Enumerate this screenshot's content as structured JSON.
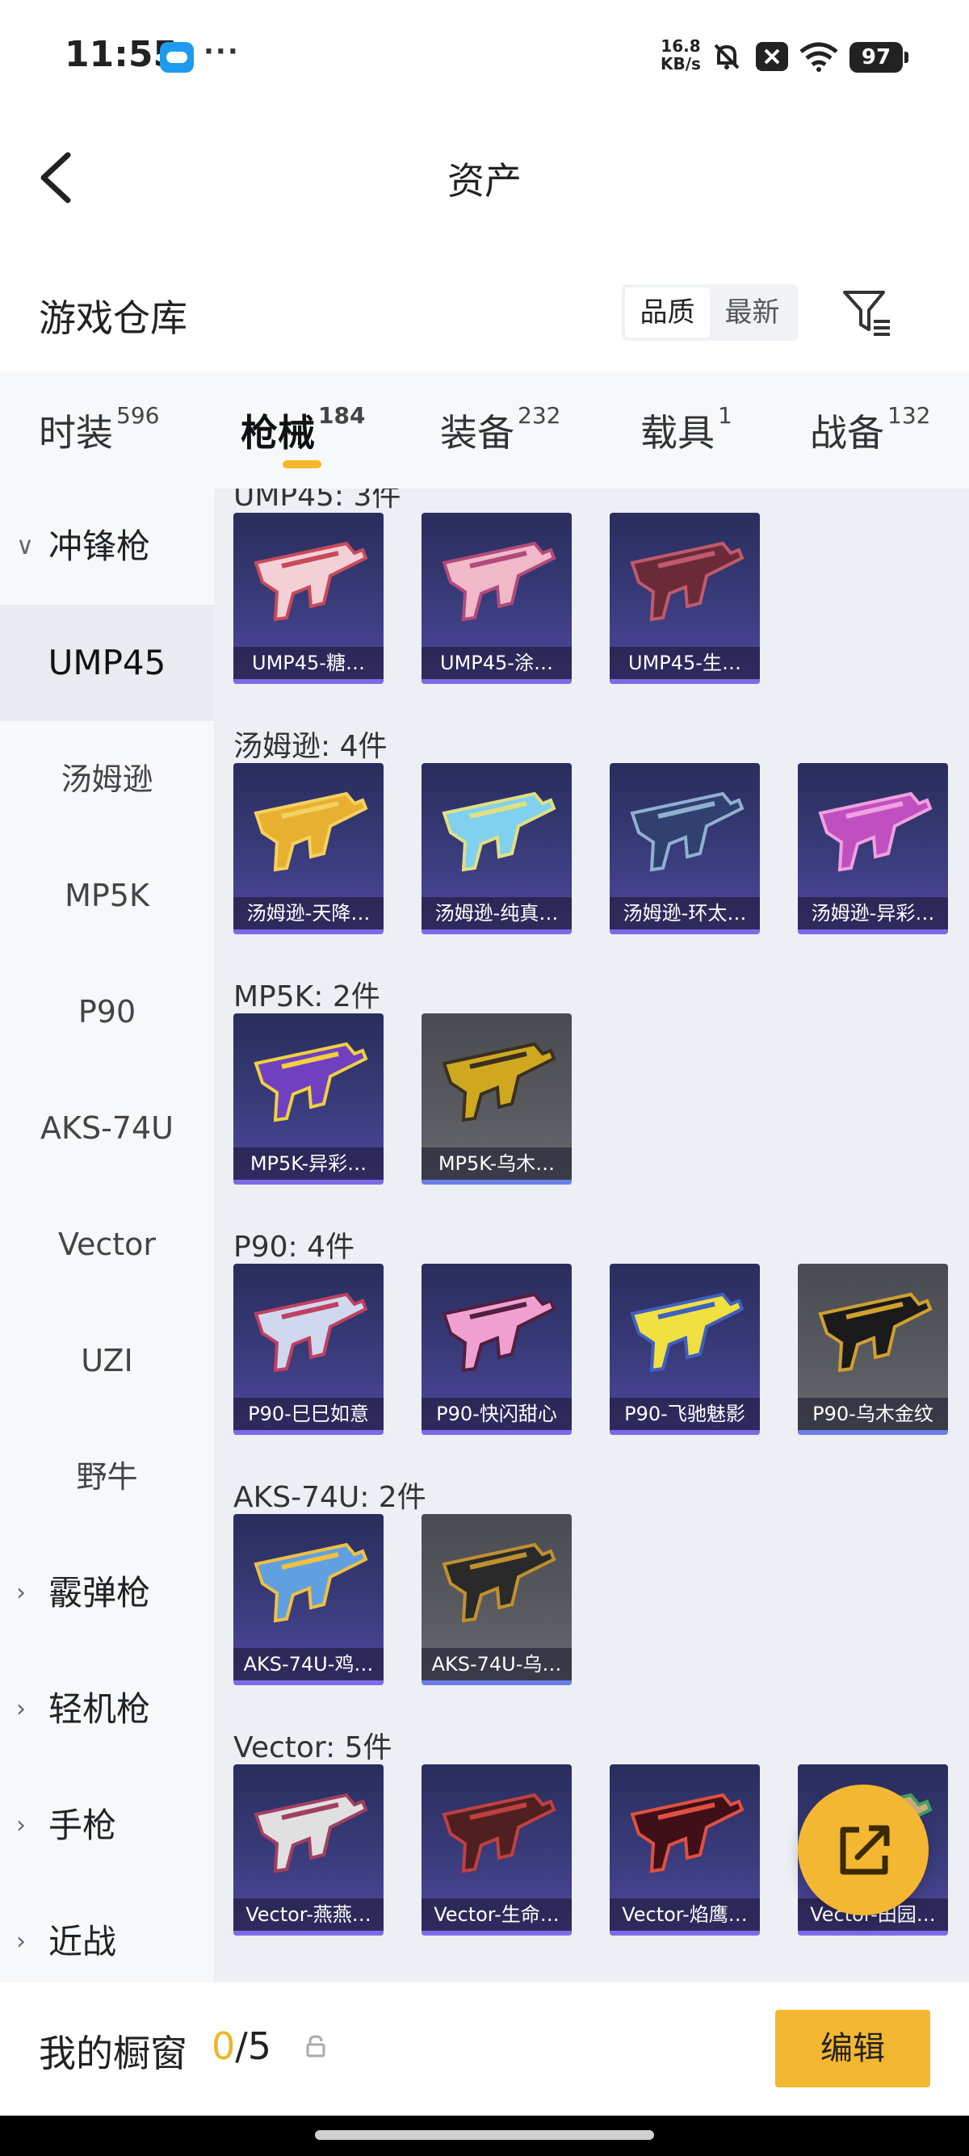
{
  "status_bar": {
    "time": "11:55",
    "more": "···",
    "speed_value": "16.8",
    "speed_unit": "KB/s",
    "battery": "97"
  },
  "nav": {
    "title": "资产",
    "back_icon": "chevron-left-icon"
  },
  "header": {
    "title": "游戏仓库",
    "sort_options": [
      "品质",
      "最新"
    ],
    "sort_active": "品质",
    "filter_icon": "filter-icon"
  },
  "tabs": [
    {
      "label": "时装",
      "count": "596"
    },
    {
      "label": "枪械",
      "count": "184",
      "active": true
    },
    {
      "label": "装备",
      "count": "232"
    },
    {
      "label": "载具",
      "count": "1"
    },
    {
      "label": "战备",
      "count": "132"
    }
  ],
  "sidebar": {
    "group_open": "冲锋枪",
    "items": [
      "UMP45",
      "汤姆逊",
      "MP5K",
      "P90",
      "AKS-74U",
      "Vector",
      "UZI",
      "野牛"
    ],
    "active_item": "UMP45",
    "groups_closed": [
      "霰弹枪",
      "轻机枪",
      "手枪",
      "近战"
    ]
  },
  "content": {
    "groups": [
      {
        "label": "UMP45: 3件",
        "items": [
          {
            "name": "UMP45-糖…",
            "rarity": "purple"
          },
          {
            "name": "UMP45-涂…",
            "rarity": "purple"
          },
          {
            "name": "UMP45-生…",
            "rarity": "purple"
          }
        ]
      },
      {
        "label": "汤姆逊: 4件",
        "items": [
          {
            "name": "汤姆逊-天降…",
            "rarity": "purple"
          },
          {
            "name": "汤姆逊-纯真…",
            "rarity": "purple"
          },
          {
            "name": "汤姆逊-环太…",
            "rarity": "purple"
          },
          {
            "name": "汤姆逊-异彩…",
            "rarity": "purple"
          }
        ]
      },
      {
        "label": "MP5K: 2件",
        "items": [
          {
            "name": "MP5K-异彩…",
            "rarity": "purple"
          },
          {
            "name": "MP5K-乌木…",
            "rarity": "grey"
          }
        ]
      },
      {
        "label": "P90: 4件",
        "items": [
          {
            "name": "P90-巳巳如意",
            "rarity": "purple"
          },
          {
            "name": "P90-快闪甜心",
            "rarity": "purple"
          },
          {
            "name": "P90-飞驰魅影",
            "rarity": "purple"
          },
          {
            "name": "P90-乌木金纹",
            "rarity": "grey"
          }
        ]
      },
      {
        "label": "AKS-74U: 2件",
        "items": [
          {
            "name": "AKS-74U-鸡…",
            "rarity": "purple"
          },
          {
            "name": "AKS-74U-乌…",
            "rarity": "grey"
          }
        ]
      },
      {
        "label": "Vector: 5件",
        "items": [
          {
            "name": "Vector-燕燕…",
            "rarity": "purple"
          },
          {
            "name": "Vector-生命…",
            "rarity": "purple"
          },
          {
            "name": "Vector-焰鹰…",
            "rarity": "purple"
          },
          {
            "name": "Vector-田园…",
            "rarity": "purple"
          }
        ]
      }
    ]
  },
  "fab_icon": "share-external-icon",
  "bottom": {
    "window_label": "我的橱窗",
    "current": "0",
    "slash": "/",
    "max": "5",
    "lock_icon": "lock-icon",
    "edit_label": "编辑"
  },
  "colors": {
    "accent": "#f4b731",
    "purple_card": "#3a3c7c",
    "grey_card": "#5a5b60"
  }
}
